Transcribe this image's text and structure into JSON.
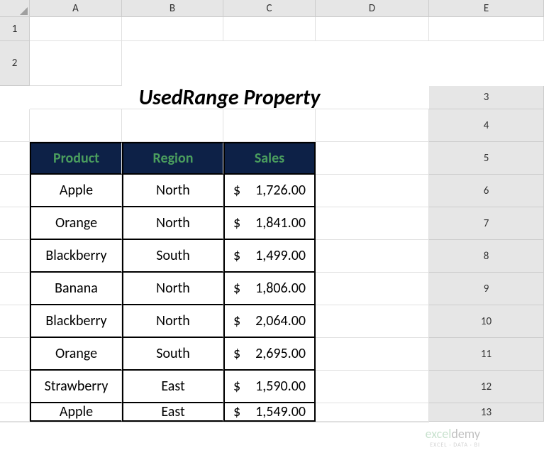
{
  "columns": [
    "A",
    "B",
    "C",
    "D",
    "E"
  ],
  "rows": [
    "1",
    "2",
    "3",
    "4",
    "5",
    "6",
    "7",
    "8",
    "9",
    "10",
    "11",
    "12",
    "13"
  ],
  "title": "UsedRange Property",
  "table": {
    "headers": [
      "Product",
      "Region",
      "Sales"
    ],
    "rows": [
      {
        "product": "Apple",
        "region": "North",
        "sales": "1,726.00"
      },
      {
        "product": "Orange",
        "region": "North",
        "sales": "1,841.00"
      },
      {
        "product": "Blackberry",
        "region": "South",
        "sales": "1,499.00"
      },
      {
        "product": "Banana",
        "region": "North",
        "sales": "1,806.00"
      },
      {
        "product": "Blackberry",
        "region": "North",
        "sales": "2,064.00"
      },
      {
        "product": "Orange",
        "region": "South",
        "sales": "2,695.00"
      },
      {
        "product": "Strawberry",
        "region": "East",
        "sales": "1,590.00"
      },
      {
        "product": "Apple",
        "region": "East",
        "sales": "1,549.00"
      }
    ]
  },
  "currency_symbol": "$",
  "watermark": {
    "brand_part1": "excel",
    "brand_part2": "demy",
    "tagline": "EXCEL · DATA · BI"
  }
}
